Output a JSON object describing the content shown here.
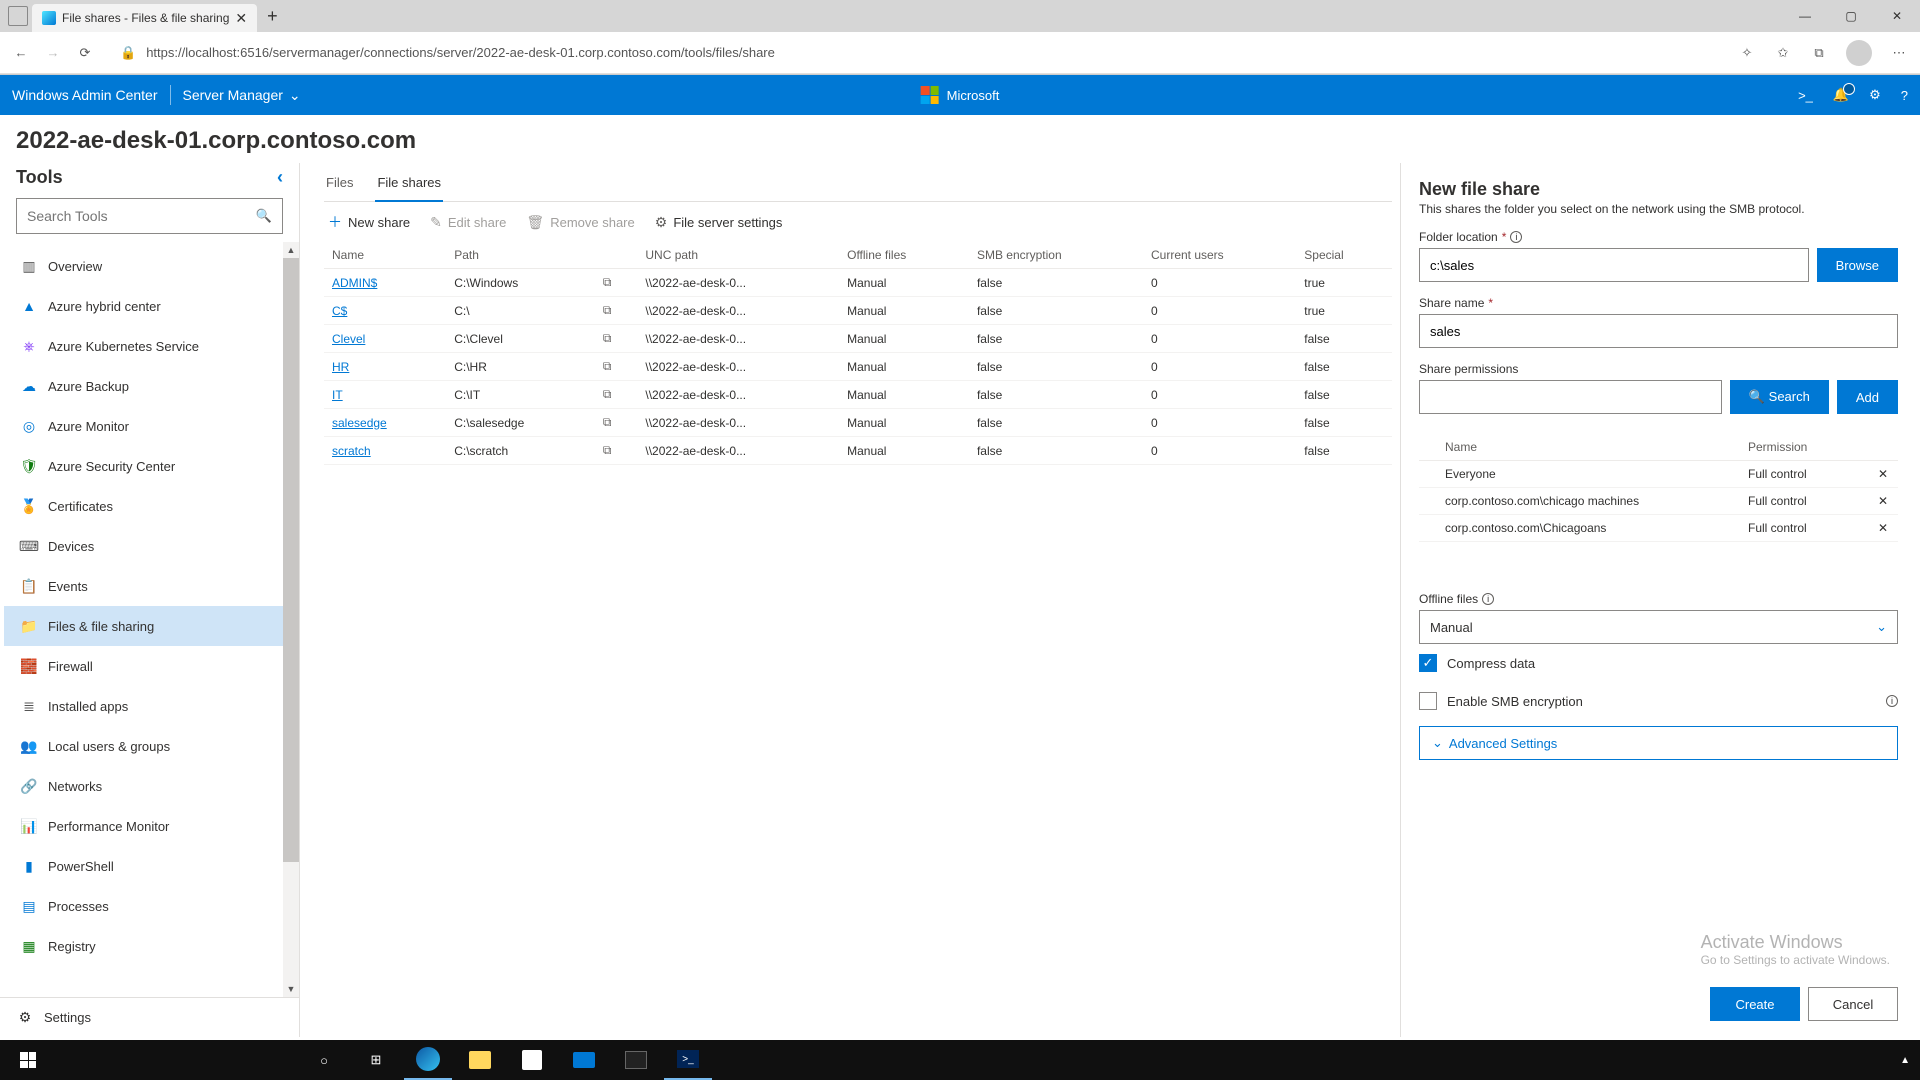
{
  "browser": {
    "tab_title": "File shares - Files & file sharing",
    "url": "https://localhost:6516/servermanager/connections/server/2022-ae-desk-01.corp.contoso.com/tools/files/share"
  },
  "header": {
    "product": "Windows Admin Center",
    "module": "Server Manager",
    "brand": "Microsoft"
  },
  "server_title": "2022-ae-desk-01.corp.contoso.com",
  "sidebar": {
    "title": "Tools",
    "search_placeholder": "Search Tools",
    "items": [
      {
        "label": "Overview",
        "icon": "▥",
        "color": "#555"
      },
      {
        "label": "Azure hybrid center",
        "icon": "▲",
        "color": "#0078d4"
      },
      {
        "label": "Azure Kubernetes Service",
        "icon": "⎈",
        "color": "#7b2ff7"
      },
      {
        "label": "Azure Backup",
        "icon": "☁",
        "color": "#0078d4"
      },
      {
        "label": "Azure Monitor",
        "icon": "◎",
        "color": "#0078d4"
      },
      {
        "label": "Azure Security Center",
        "icon": "🛡",
        "color": "#107c10"
      },
      {
        "label": "Certificates",
        "icon": "🏅",
        "color": "#d83b01"
      },
      {
        "label": "Devices",
        "icon": "⌨",
        "color": "#555"
      },
      {
        "label": "Events",
        "icon": "📋",
        "color": "#555"
      },
      {
        "label": "Files & file sharing",
        "icon": "📁",
        "color": "#ffb900"
      },
      {
        "label": "Firewall",
        "icon": "🧱",
        "color": "#d13438"
      },
      {
        "label": "Installed apps",
        "icon": "≣",
        "color": "#555"
      },
      {
        "label": "Local users & groups",
        "icon": "👥",
        "color": "#0078d4"
      },
      {
        "label": "Networks",
        "icon": "🔗",
        "color": "#555"
      },
      {
        "label": "Performance Monitor",
        "icon": "📊",
        "color": "#0078d4"
      },
      {
        "label": "PowerShell",
        "icon": "▮",
        "color": "#0078d4"
      },
      {
        "label": "Processes",
        "icon": "▤",
        "color": "#0078d4"
      },
      {
        "label": "Registry",
        "icon": "▦",
        "color": "#107c10"
      }
    ],
    "settings": "Settings"
  },
  "content": {
    "tabs": [
      {
        "label": "Files"
      },
      {
        "label": "File shares"
      }
    ],
    "cmdbar": {
      "new": "New share",
      "edit": "Edit share",
      "remove": "Remove share",
      "settings": "File server settings"
    },
    "columns": [
      "Name",
      "Path",
      "",
      "UNC path",
      "Offline files",
      "SMB encryption",
      "Current users",
      "Special"
    ],
    "rows": [
      {
        "name": "ADMIN$",
        "path": "C:\\Windows",
        "unc": "\\\\2022-ae-desk-0...",
        "offline": "Manual",
        "smb": "false",
        "users": "0",
        "special": "true"
      },
      {
        "name": "C$",
        "path": "C:\\",
        "unc": "\\\\2022-ae-desk-0...",
        "offline": "Manual",
        "smb": "false",
        "users": "0",
        "special": "true"
      },
      {
        "name": "Clevel",
        "path": "C:\\Clevel",
        "unc": "\\\\2022-ae-desk-0...",
        "offline": "Manual",
        "smb": "false",
        "users": "0",
        "special": "false"
      },
      {
        "name": "HR",
        "path": "C:\\HR",
        "unc": "\\\\2022-ae-desk-0...",
        "offline": "Manual",
        "smb": "false",
        "users": "0",
        "special": "false"
      },
      {
        "name": "IT",
        "path": "C:\\IT",
        "unc": "\\\\2022-ae-desk-0...",
        "offline": "Manual",
        "smb": "false",
        "users": "0",
        "special": "false"
      },
      {
        "name": "salesedge",
        "path": "C:\\salesedge",
        "unc": "\\\\2022-ae-desk-0...",
        "offline": "Manual",
        "smb": "false",
        "users": "0",
        "special": "false"
      },
      {
        "name": "scratch",
        "path": "C:\\scratch",
        "unc": "\\\\2022-ae-desk-0...",
        "offline": "Manual",
        "smb": "false",
        "users": "0",
        "special": "false"
      }
    ]
  },
  "panel": {
    "title": "New file share",
    "subtitle": "This shares the folder you select on the network using the SMB protocol.",
    "folder_label": "Folder location",
    "folder_value": "c:\\sales",
    "browse": "Browse",
    "name_label": "Share name",
    "name_value": "sales",
    "perm_label": "Share permissions",
    "search": "Search",
    "add": "Add",
    "perm_cols": {
      "name": "Name",
      "perm": "Permission"
    },
    "perms": [
      {
        "name": "Everyone",
        "perm": "Full control"
      },
      {
        "name": "corp.contoso.com\\chicago machines",
        "perm": "Full control"
      },
      {
        "name": "corp.contoso.com\\Chicagoans",
        "perm": "Full control"
      }
    ],
    "offline_label": "Offline files",
    "offline_value": "Manual",
    "compress": "Compress data",
    "smb": "Enable SMB encryption",
    "advanced": "Advanced Settings",
    "create": "Create",
    "cancel": "Cancel"
  },
  "watermark": {
    "title": "Activate Windows",
    "sub": "Go to Settings to activate Windows."
  }
}
